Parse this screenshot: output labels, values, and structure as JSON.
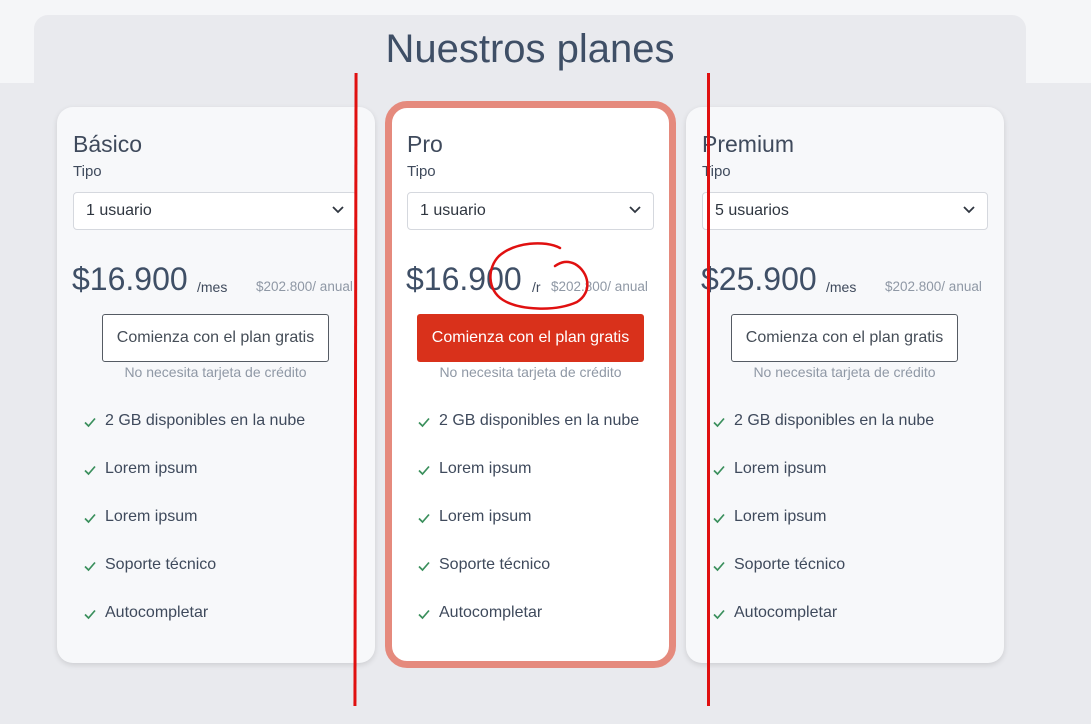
{
  "page": {
    "title": "Nuestros planes"
  },
  "common": {
    "tipo_label": "Tipo",
    "no_card_text": "No necesita tarjeta de crédito",
    "features": [
      "2 GB disponibles en la nube",
      "Lorem ipsum",
      "Lorem ipsum",
      "Soporte técnico",
      "Autocompletar"
    ]
  },
  "plans": [
    {
      "name": "Básico",
      "type_value": "1 usuario",
      "price": "$16.900",
      "period": "/mes",
      "annual": "$202.800/ anual",
      "cta": "Comienza con el plan gratis"
    },
    {
      "name": "Pro",
      "type_value": "1 usuario",
      "price": "$16.900",
      "period": "/r",
      "annual": "$202.800/ anual",
      "cta": "Comienza con el plan gratis"
    },
    {
      "name": "Premium",
      "type_value": "5 usuarios",
      "price": "$25.900",
      "period": "/mes",
      "annual": "$202.800/ anual",
      "cta": "Comienza con el plan gratis"
    }
  ],
  "colors": {
    "accent": "#d9311b",
    "highlight_border": "#e58a7d",
    "check": "#3a8f5c",
    "annotation": "#e01010"
  },
  "icons": {
    "select_caret": "chevron-down-icon",
    "feature": "check-icon"
  }
}
